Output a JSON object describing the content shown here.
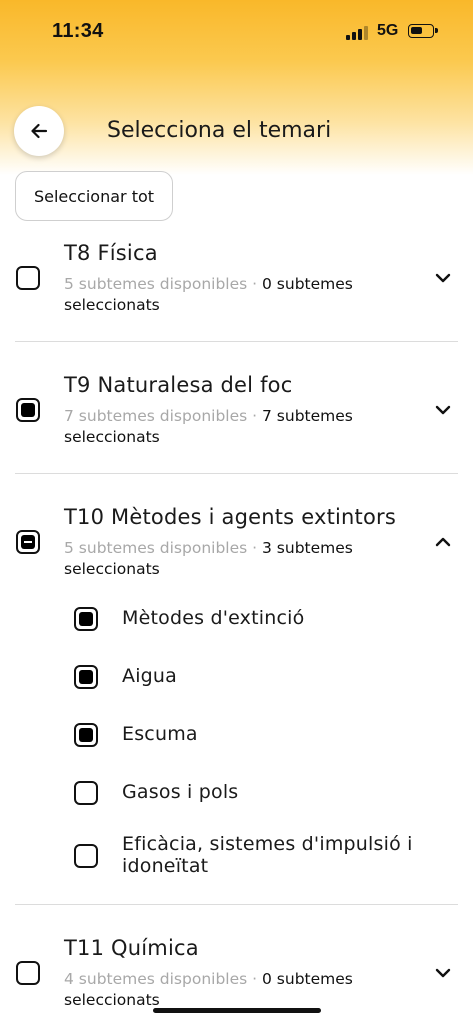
{
  "status_bar": {
    "time": "11:34",
    "network": "5G",
    "battery_level": 0.6
  },
  "header": {
    "title": "Selecciona el temari"
  },
  "select_all_label": "Seleccionar tot",
  "topics": [
    {
      "title": "T8 Física",
      "available": "5 subtemes disponibles",
      "separator": " · ",
      "selected": "0 subtemes seleccionats",
      "state": "unchecked",
      "expanded": false
    },
    {
      "title": "T9 Naturalesa del foc",
      "available": "7 subtemes disponibles",
      "separator": " · ",
      "selected": "7 subtemes seleccionats",
      "state": "checked",
      "expanded": false
    },
    {
      "title": "T10 Mètodes i agents extintors",
      "available": "5 subtemes disponibles",
      "separator": " · ",
      "selected": "3 subtemes seleccionats",
      "state": "partial",
      "expanded": true,
      "subtopics": [
        {
          "label": "Mètodes d'extinció",
          "checked": true
        },
        {
          "label": "Aigua",
          "checked": true
        },
        {
          "label": "Escuma",
          "checked": true
        },
        {
          "label": "Gasos i pols",
          "checked": false
        },
        {
          "label": "Eficàcia, sistemes d'impulsió i idoneïtat",
          "checked": false
        }
      ]
    },
    {
      "title": "T11 Química",
      "available": "4 subtemes disponibles",
      "separator": " · ",
      "selected": "0 subtemes seleccionats",
      "state": "unchecked",
      "expanded": false
    }
  ]
}
